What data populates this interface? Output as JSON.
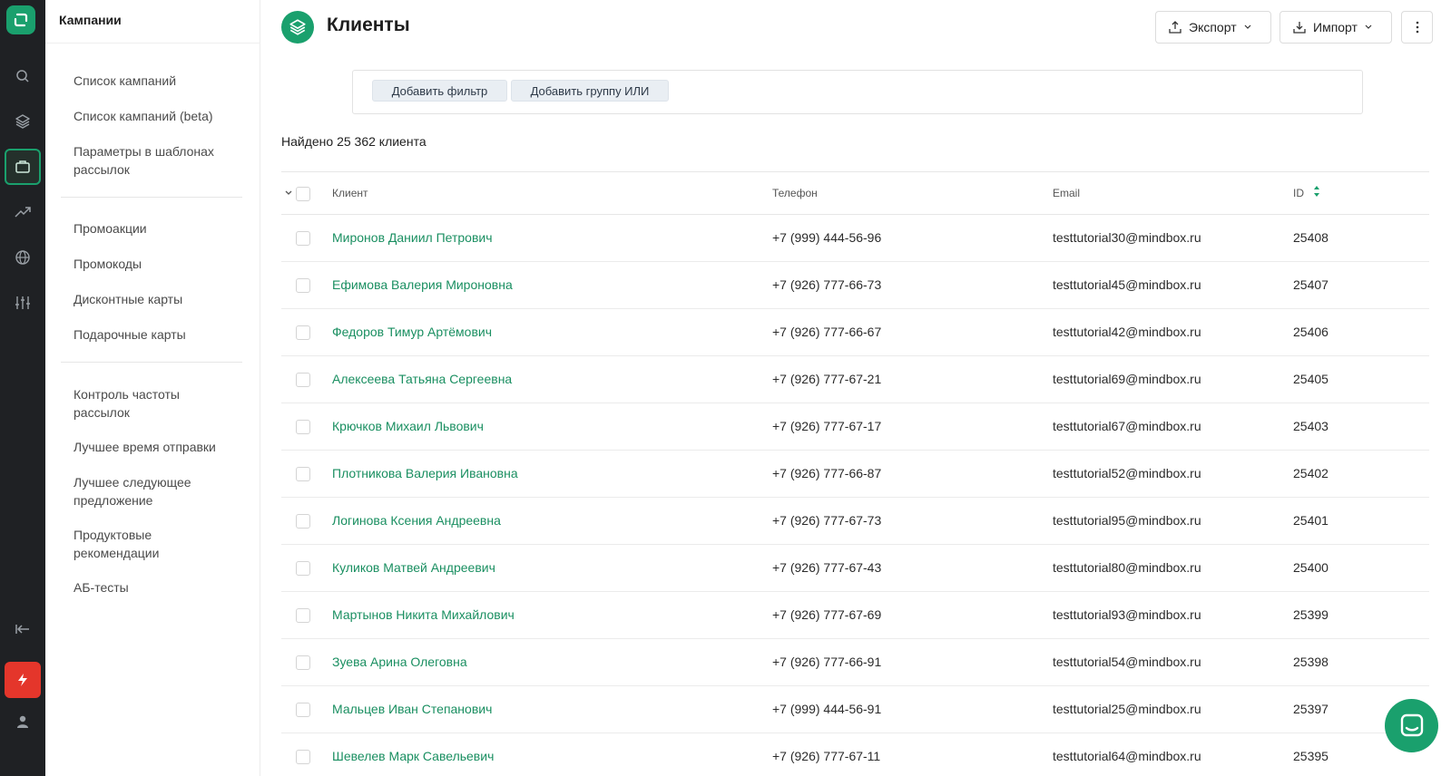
{
  "rail": {
    "icons": [
      "logo-icon",
      "search-icon",
      "layers-icon",
      "campaigns-icon",
      "analytics-icon",
      "globe-icon",
      "settings-icon",
      "collapse-icon",
      "lightning-icon",
      "user-icon"
    ]
  },
  "sidebar": {
    "title": "Кампании",
    "group1": [
      {
        "label": "Список кампаний"
      },
      {
        "label": "Список кампаний (beta)"
      },
      {
        "label": "Параметры в шаблонах рассылок"
      }
    ],
    "group2": [
      {
        "label": "Промоакции"
      },
      {
        "label": "Промокоды"
      },
      {
        "label": "Дисконтные карты"
      },
      {
        "label": "Подарочные карты"
      }
    ],
    "group3": [
      {
        "label": "Контроль частоты рассылок"
      },
      {
        "label": "Лучшее время отправки"
      },
      {
        "label": "Лучшее следующее предложение"
      },
      {
        "label": "Продуктовые рекомендации"
      },
      {
        "label": "АБ-тесты"
      }
    ]
  },
  "header": {
    "title": "Клиенты",
    "export_label": "Экспорт",
    "import_label": "Импорт"
  },
  "filters": {
    "add_filter": "Добавить фильтр",
    "add_or_group": "Добавить группу ИЛИ"
  },
  "found_text": "Найдено 25 362 клиента",
  "table": {
    "columns": {
      "client": "Клиент",
      "phone": "Телефон",
      "email": "Email",
      "id": "ID"
    },
    "rows": [
      {
        "name": "Миронов Даниил Петрович",
        "phone": "+7 (999) 444-56-96",
        "email": "testtutorial30@mindbox.ru",
        "id": "25408"
      },
      {
        "name": "Ефимова Валерия Мироновна",
        "phone": "+7 (926) 777-66-73",
        "email": "testtutorial45@mindbox.ru",
        "id": "25407"
      },
      {
        "name": "Федоров Тимур Артёмович",
        "phone": "+7 (926) 777-66-67",
        "email": "testtutorial42@mindbox.ru",
        "id": "25406"
      },
      {
        "name": "Алексеева Татьяна Сергеевна",
        "phone": "+7 (926) 777-67-21",
        "email": "testtutorial69@mindbox.ru",
        "id": "25405"
      },
      {
        "name": "Крючков Михаил Львович",
        "phone": "+7 (926) 777-67-17",
        "email": "testtutorial67@mindbox.ru",
        "id": "25403"
      },
      {
        "name": "Плотникова Валерия Ивановна",
        "phone": "+7 (926) 777-66-87",
        "email": "testtutorial52@mindbox.ru",
        "id": "25402"
      },
      {
        "name": "Логинова Ксения Андреевна",
        "phone": "+7 (926) 777-67-73",
        "email": "testtutorial95@mindbox.ru",
        "id": "25401"
      },
      {
        "name": "Куликов Матвей Андреевич",
        "phone": "+7 (926) 777-67-43",
        "email": "testtutorial80@mindbox.ru",
        "id": "25400"
      },
      {
        "name": "Мартынов Никита Михайлович",
        "phone": "+7 (926) 777-67-69",
        "email": "testtutorial93@mindbox.ru",
        "id": "25399"
      },
      {
        "name": "Зуева Арина Олеговна",
        "phone": "+7 (926) 777-66-91",
        "email": "testtutorial54@mindbox.ru",
        "id": "25398"
      },
      {
        "name": "Мальцев Иван Степанович",
        "phone": "+7 (999) 444-56-91",
        "email": "testtutorial25@mindbox.ru",
        "id": "25397"
      },
      {
        "name": "Шевелев Марк Савельевич",
        "phone": "+7 (926) 777-67-11",
        "email": "testtutorial64@mindbox.ru",
        "id": "25395"
      }
    ]
  },
  "colors": {
    "accent": "#1aa06d",
    "rail_bg": "#1f2124",
    "danger": "#e4362b",
    "link": "#1a8f61"
  }
}
